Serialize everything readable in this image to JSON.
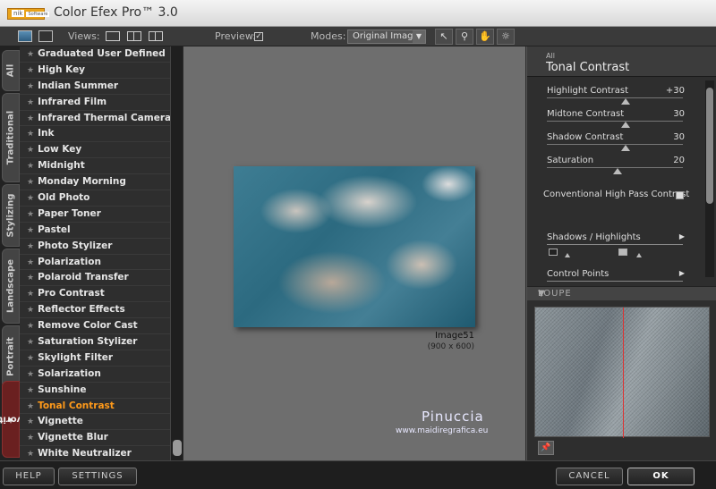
{
  "window": {
    "title": "Color Efex Pro™ 3.0",
    "logo_text": "nik",
    "logo_sub": "Software"
  },
  "toolbar": {
    "views_label": "Views:",
    "preview_label": "Preview:",
    "preview_checked": "✓",
    "modes_label": "Modes:",
    "mode_value": "Original Image",
    "tools": [
      {
        "name": "pointer-tool-icon",
        "glyph": "↖"
      },
      {
        "name": "zoom-tool-icon",
        "glyph": "🔍"
      },
      {
        "name": "hand-tool-icon",
        "glyph": "✋"
      },
      {
        "name": "light-tool-icon",
        "glyph": "☼"
      }
    ]
  },
  "category_tabs": [
    "All",
    "Traditional",
    "Stylizing",
    "Landscape",
    "Portrait",
    "Favorites"
  ],
  "filters": [
    "Graduated User Defined",
    "High Key",
    "Indian Summer",
    "Infrared Film",
    "Infrared Thermal Camera",
    "Ink",
    "Low Key",
    "Midnight",
    "Monday Morning",
    "Old Photo",
    "Paper Toner",
    "Pastel",
    "Photo Stylizer",
    "Polarization",
    "Polaroid Transfer",
    "Pro Contrast",
    "Reflector Effects",
    "Remove Color Cast",
    "Saturation Stylizer",
    "Skylight Filter",
    "Solarization",
    "Sunshine",
    "Tonal Contrast",
    "Vignette",
    "Vignette Blur",
    "White Neutralizer"
  ],
  "selected_filter": "Tonal Contrast",
  "preview": {
    "image_name": "Image51",
    "image_size": "(900 x 600)",
    "watermark": "Pinuccia",
    "watermark_url": "www.maidiregrafica.eu"
  },
  "panel": {
    "category": "All",
    "title": "Tonal Contrast",
    "sliders": [
      {
        "label": "Highlight Contrast",
        "value": "+30",
        "position": 0.58
      },
      {
        "label": "Midtone Contrast",
        "value": "30",
        "position": 0.58
      },
      {
        "label": "Shadow Contrast",
        "value": "30",
        "position": 0.58
      },
      {
        "label": "Saturation",
        "value": "20",
        "position": 0.52
      }
    ],
    "checkbox_label": "Conventional High Pass Contrast",
    "shadows_highlights": "Shadows / Highlights",
    "control_points": "Control Points",
    "loupe": "LOUPE"
  },
  "bottom": {
    "help": "HELP",
    "settings": "SETTINGS",
    "cancel": "CANCEL",
    "ok": "OK"
  }
}
